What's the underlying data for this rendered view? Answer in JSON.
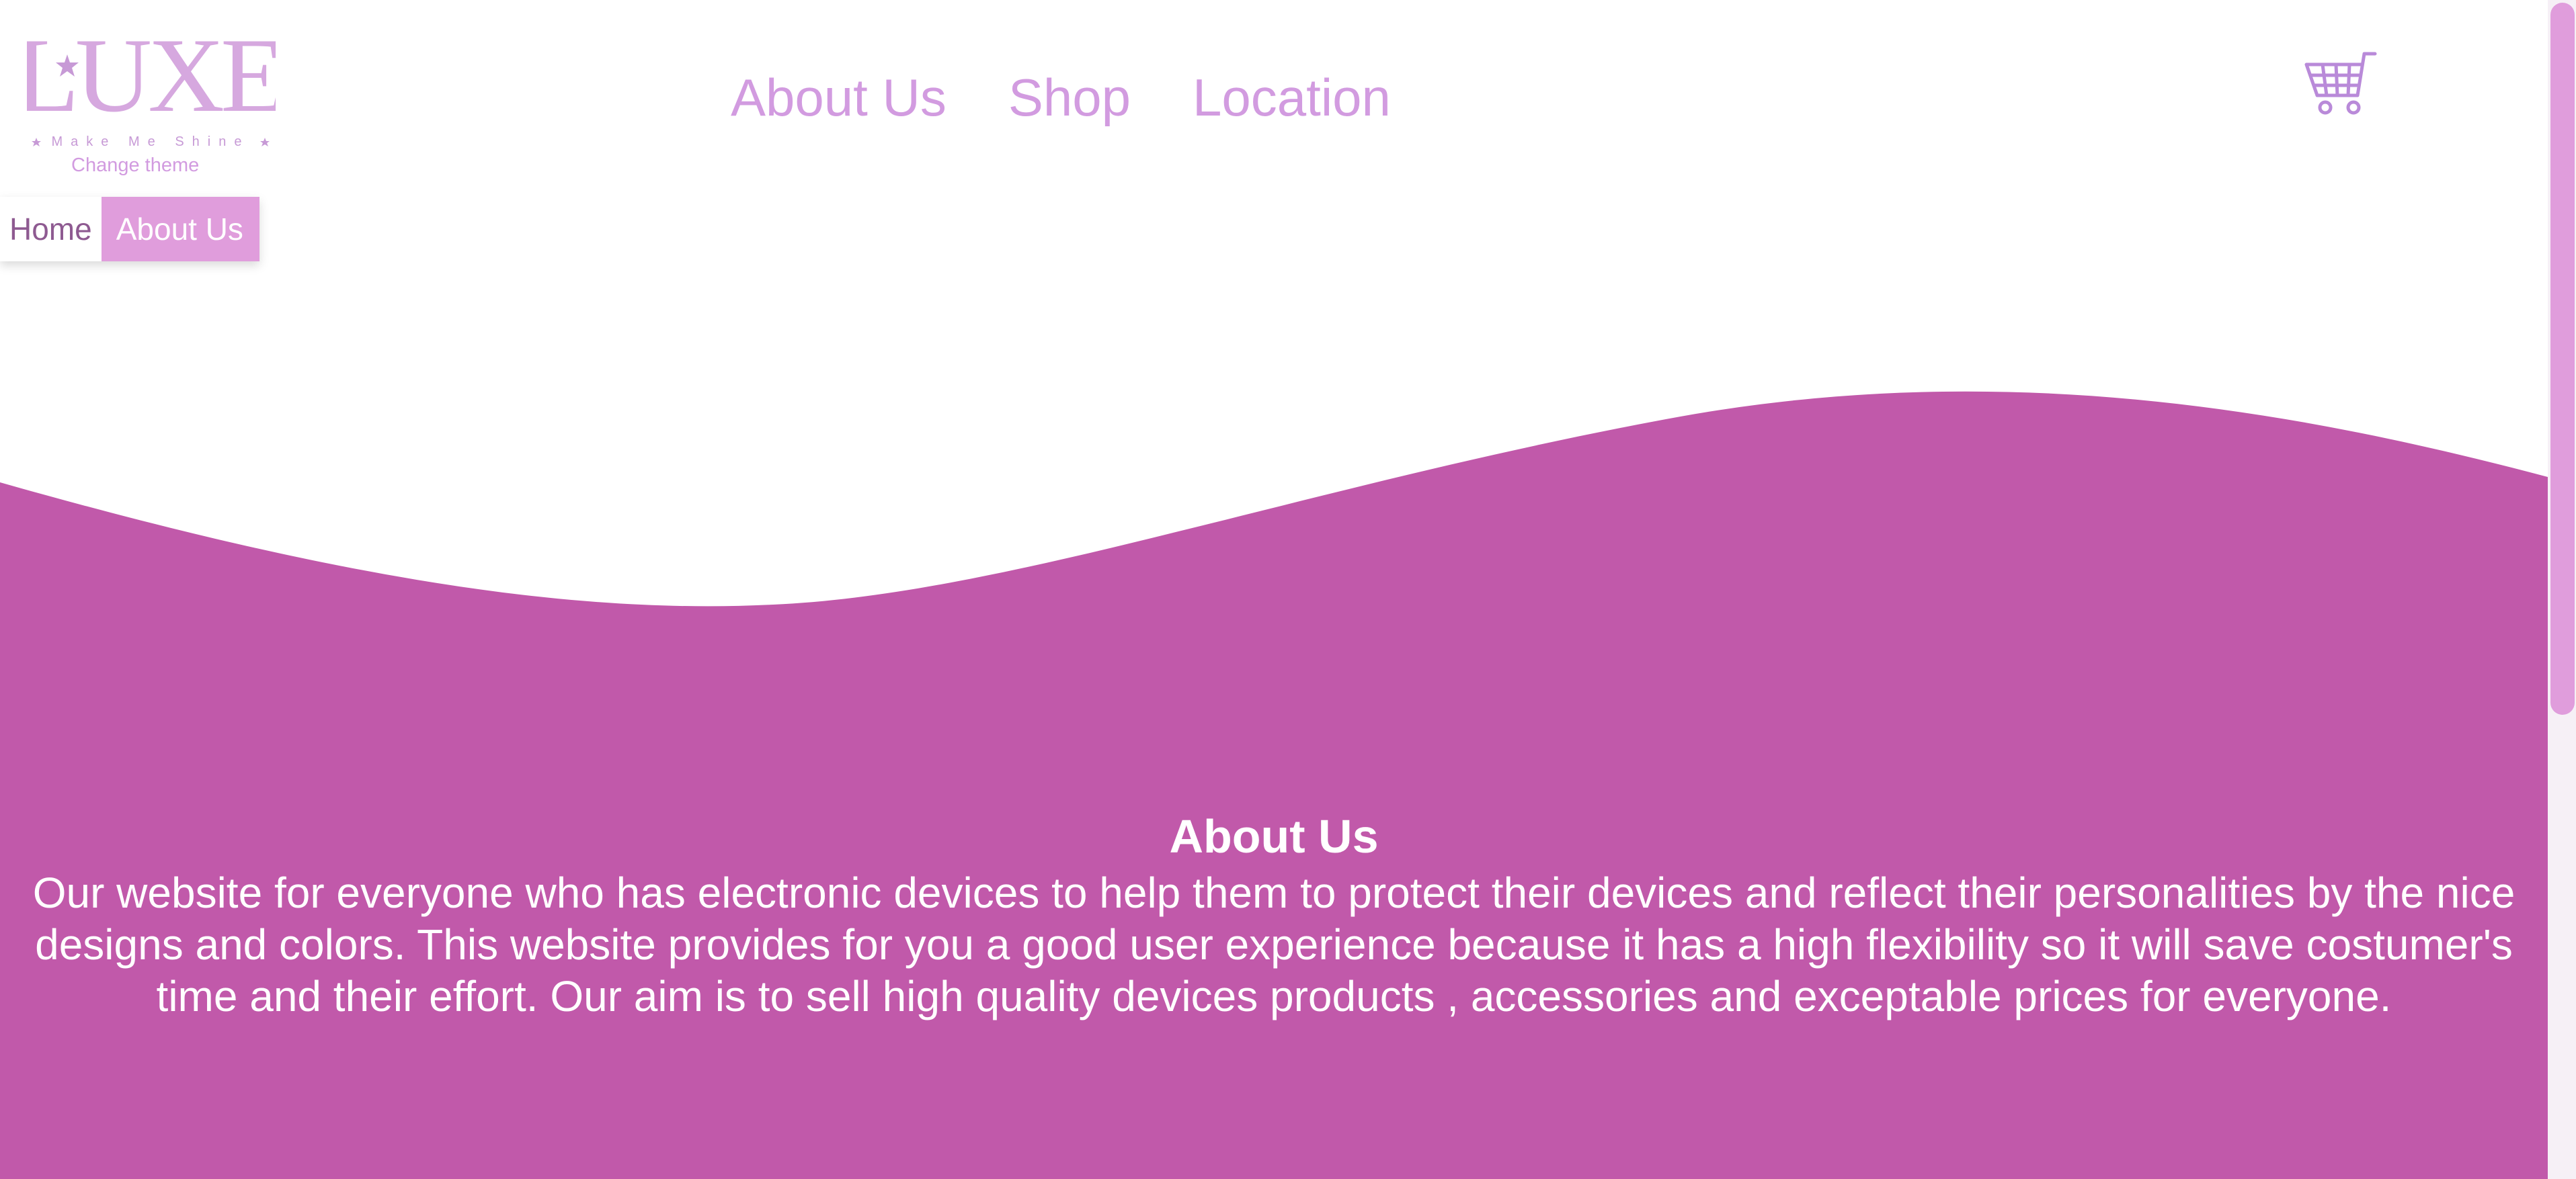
{
  "logo": {
    "wordmark": "LUXE",
    "tagline": "Make Me Shine"
  },
  "theme": {
    "change_label": "Change theme"
  },
  "nav": {
    "items": [
      {
        "label": "About Us"
      },
      {
        "label": "Shop"
      },
      {
        "label": "Location"
      }
    ]
  },
  "cart": {
    "icon": "shopping-cart-icon"
  },
  "breadcrumb": {
    "home": "Home",
    "current": "About Us"
  },
  "about": {
    "title": "About Us",
    "text": "Our website for everyone who has electronic devices to help them to protect their devices and reflect their personalities by the nice designs and colors. This website provides for you a good user experience because it has a high flexibility so it will save costumer's time and their effort. Our aim is to sell high quality devices products , accessories and exceptable prices for everyone."
  },
  "colors": {
    "brand_light": "#d29be0",
    "brand_accent": "#e09ddc",
    "section_bg": "#c159aa",
    "text_on_section": "#ffffff"
  }
}
